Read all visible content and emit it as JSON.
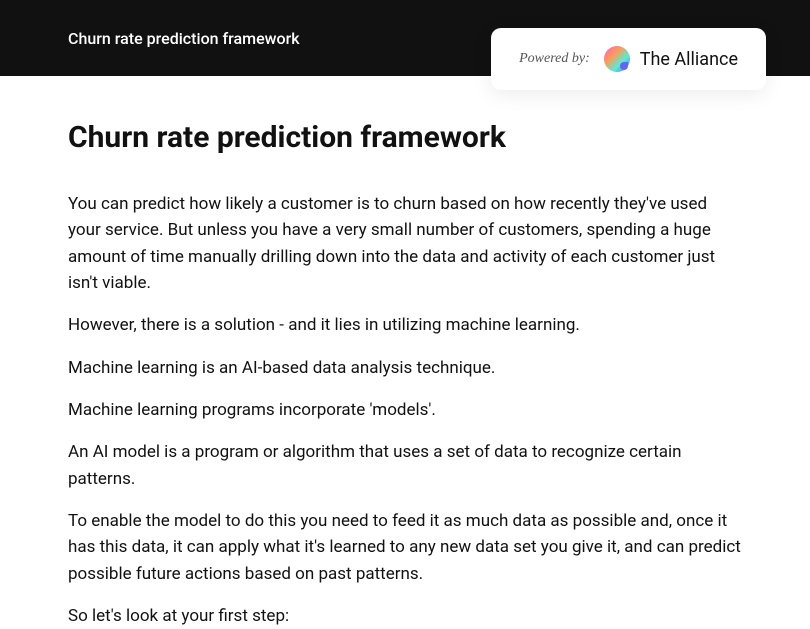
{
  "header": {
    "title": "Churn rate prediction framework"
  },
  "powered": {
    "label": "Powered by:",
    "brand": "The Alliance"
  },
  "page": {
    "title": "Churn rate prediction framework",
    "paragraphs": [
      "You can predict how likely a customer is to churn based on how recently they've used your service. But unless you have a very small number of customers, spending a huge amount of time manually drilling down into the data and activity of each customer just isn't viable.",
      "However, there is a solution - and it lies in utilizing machine learning.",
      "Machine learning is an AI-based data analysis technique.",
      "Machine learning programs incorporate 'models'.",
      "An AI model is a program or algorithm that uses a set of data to recognize certain patterns.",
      "To enable the model to do this you need to feed it as much data as possible and, once it has this data, it can apply what it's learned to any new data set you give it, and can predict possible future actions based on past patterns.",
      "So let's look at your first step:"
    ]
  }
}
